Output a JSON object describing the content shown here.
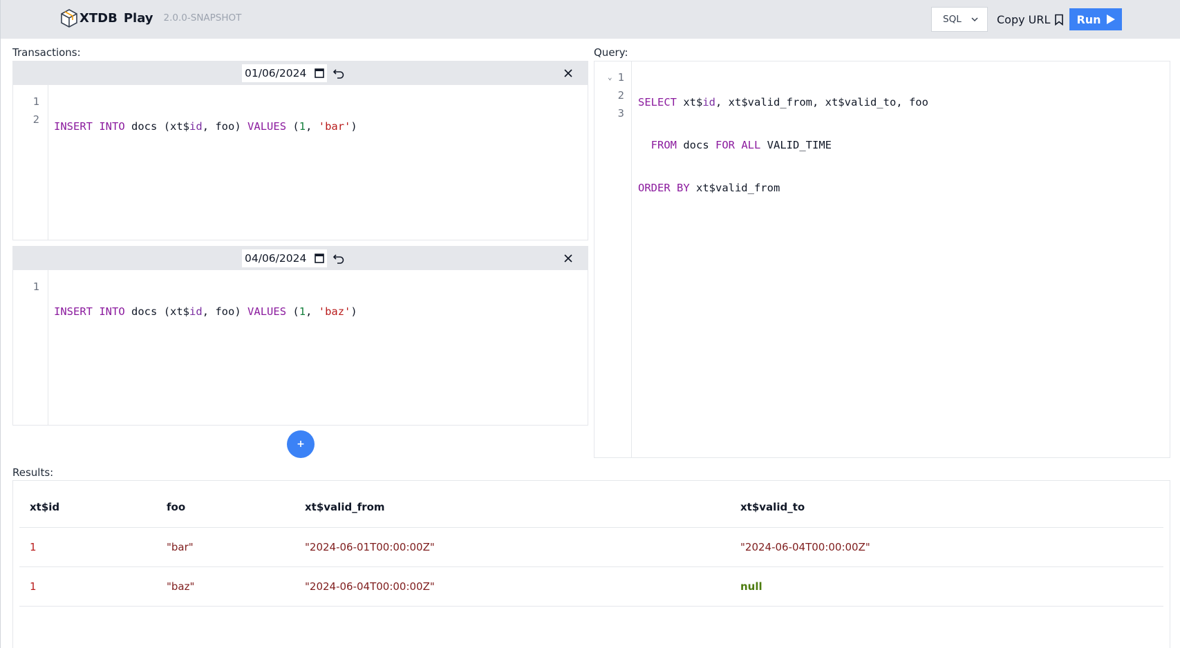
{
  "header": {
    "brand": "XTDB",
    "brand_suffix": "Play",
    "version": "2.0.0-SNAPSHOT",
    "language_select": "SQL",
    "copy_url_label": "Copy URL",
    "run_label": "Run"
  },
  "transactions": {
    "label": "Transactions:",
    "items": [
      {
        "date": "01/06/2024",
        "line_numbers": [
          "1",
          "2"
        ],
        "code": {
          "kw1": "INSERT",
          "kw2": "INTO",
          "table": "docs",
          "cols_open": "(xt$",
          "cols_id": "id",
          "cols_rest": ", foo)",
          "kw3": "VALUES",
          "vals_open": "(",
          "num": "1",
          "comma": ", ",
          "str": "'bar'",
          "vals_close": ")"
        }
      },
      {
        "date": "04/06/2024",
        "line_numbers": [
          "1"
        ],
        "code": {
          "kw1": "INSERT",
          "kw2": "INTO",
          "table": "docs",
          "cols_open": "(xt$",
          "cols_id": "id",
          "cols_rest": ", foo)",
          "kw3": "VALUES",
          "vals_open": "(",
          "num": "1",
          "comma": ", ",
          "str": "'baz'",
          "vals_close": ")"
        }
      }
    ],
    "add_label": "+"
  },
  "query": {
    "label": "Query:",
    "line_numbers": [
      "1",
      "2",
      "3"
    ],
    "lines": {
      "l1_kw": "SELECT",
      "l1_a": " xt$",
      "l1_id": "id",
      "l1_b": ", xt$valid_from, xt$valid_to, foo",
      "l2_indent": "  ",
      "l2_kw1": "FROM",
      "l2_a": " docs ",
      "l2_kw2": "FOR ALL",
      "l2_b": " VALID_TIME",
      "l3_kw": "ORDER BY",
      "l3_a": " xt$valid_from"
    }
  },
  "results": {
    "label": "Results:",
    "columns": [
      "xt$id",
      "foo",
      "xt$valid_from",
      "xt$valid_to"
    ],
    "rows": [
      [
        "1",
        "\"bar\"",
        "\"2024-06-01T00:00:00Z\"",
        "\"2024-06-04T00:00:00Z\""
      ],
      [
        "1",
        "\"baz\"",
        "\"2024-06-04T00:00:00Z\"",
        "null"
      ]
    ]
  },
  "colors": {
    "accent": "#3b82f6",
    "keyword": "#8b1b9e",
    "string": "#b91c1c",
    "number": "#15803d",
    "null": "#4d7c0f"
  }
}
